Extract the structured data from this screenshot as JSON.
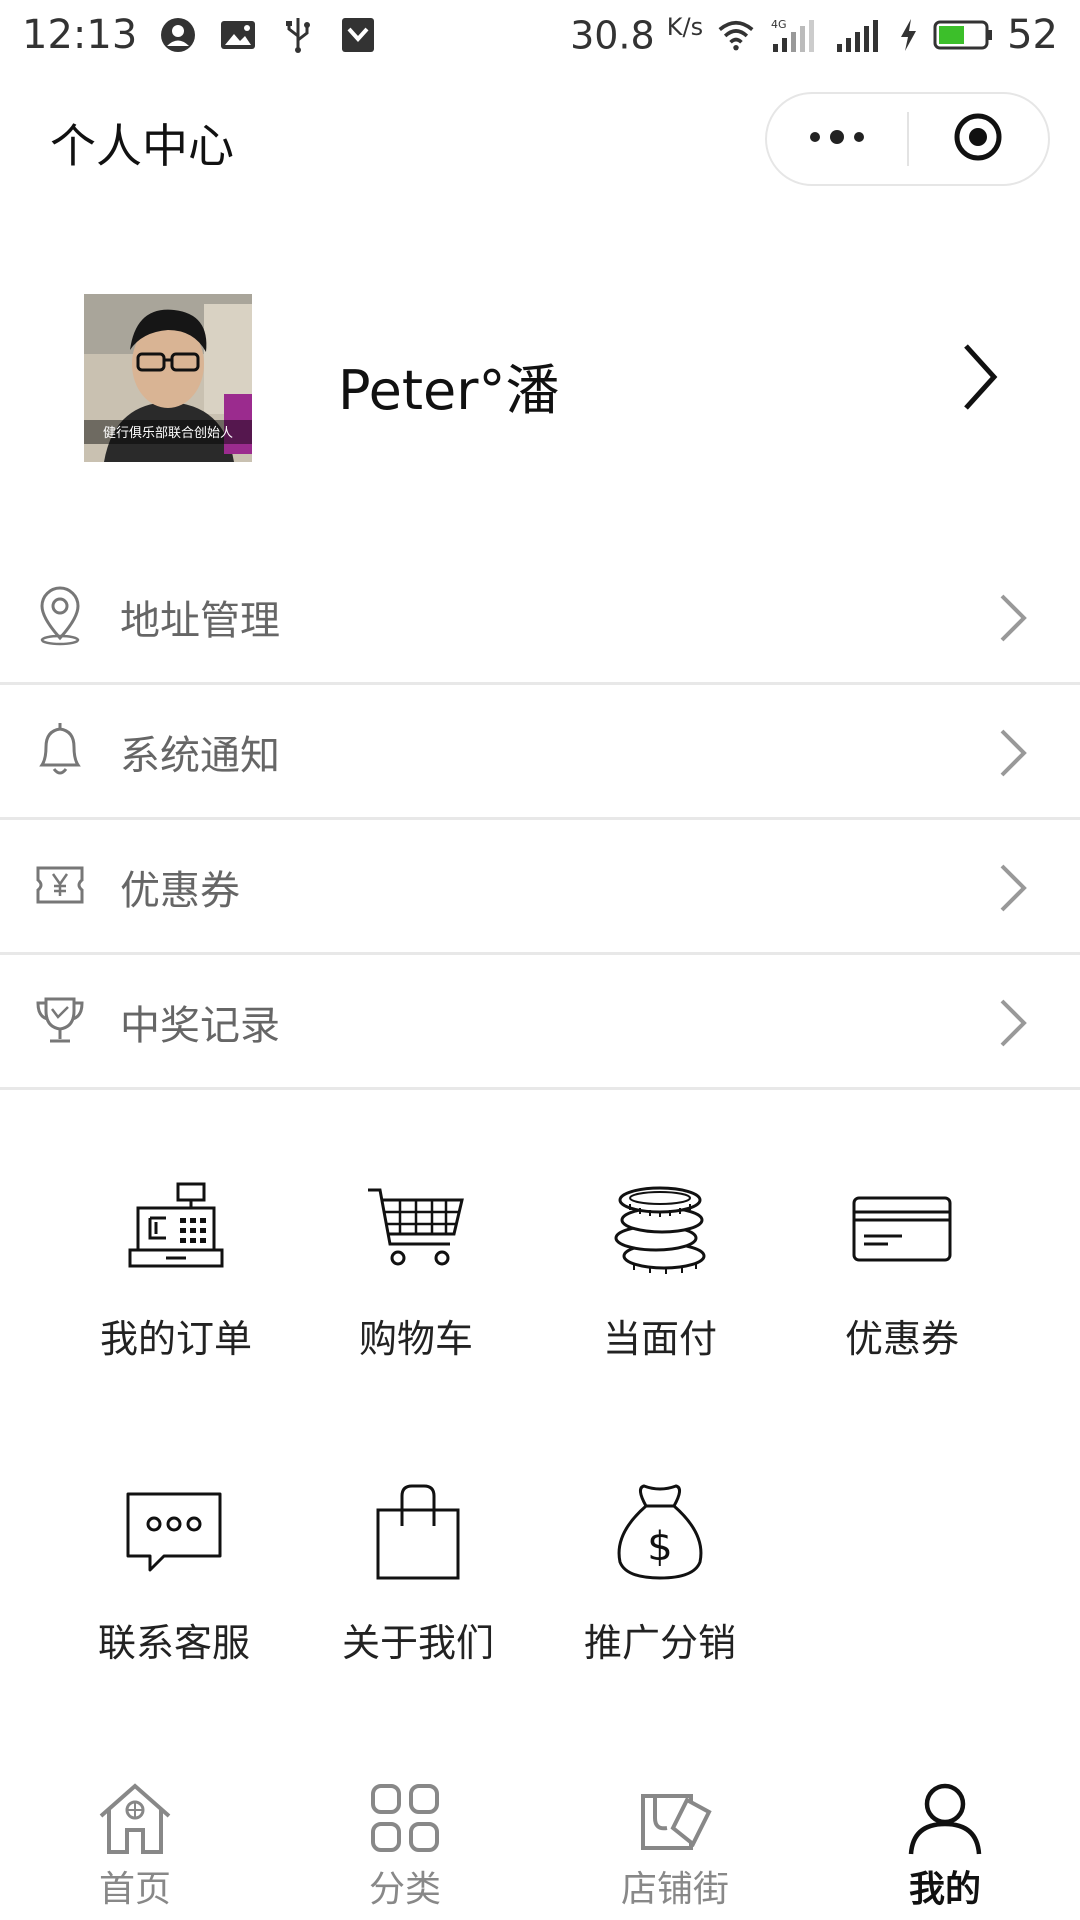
{
  "status_bar": {
    "time": "12:13",
    "net_speed": "30.8",
    "net_unit": "K/s",
    "signal_type": "4G",
    "battery": "52",
    "battery_color": "#3cbf2a"
  },
  "header": {
    "title": "个人中心",
    "more_icon": "more-dots-icon",
    "close_icon": "target-circle-icon"
  },
  "profile": {
    "avatar_caption": "健行俱乐部联合创始人",
    "username": "Peter°潘"
  },
  "menu": [
    {
      "label": "地址管理",
      "icon": "location-pin-icon"
    },
    {
      "label": "系统通知",
      "icon": "bell-icon"
    },
    {
      "label": "优惠券",
      "icon": "coupon-icon"
    },
    {
      "label": "中奖记录",
      "icon": "trophy-icon"
    }
  ],
  "grid": [
    {
      "label": "我的订单",
      "icon": "cash-register-icon"
    },
    {
      "label": "购物车",
      "icon": "shopping-cart-icon"
    },
    {
      "label": "当面付",
      "icon": "coins-icon"
    },
    {
      "label": "优惠券",
      "icon": "card-icon"
    },
    {
      "label": "联系客服",
      "icon": "chat-bubble-icon"
    },
    {
      "label": "关于我们",
      "icon": "shopping-bag-icon"
    },
    {
      "label": "推广分销",
      "icon": "money-bag-icon"
    }
  ],
  "tabbar": [
    {
      "label": "首页",
      "icon": "home-icon",
      "active": false
    },
    {
      "label": "分类",
      "icon": "grid-icon",
      "active": false
    },
    {
      "label": "店铺街",
      "icon": "shop-icon",
      "active": false
    },
    {
      "label": "我的",
      "icon": "user-icon",
      "active": true
    }
  ]
}
